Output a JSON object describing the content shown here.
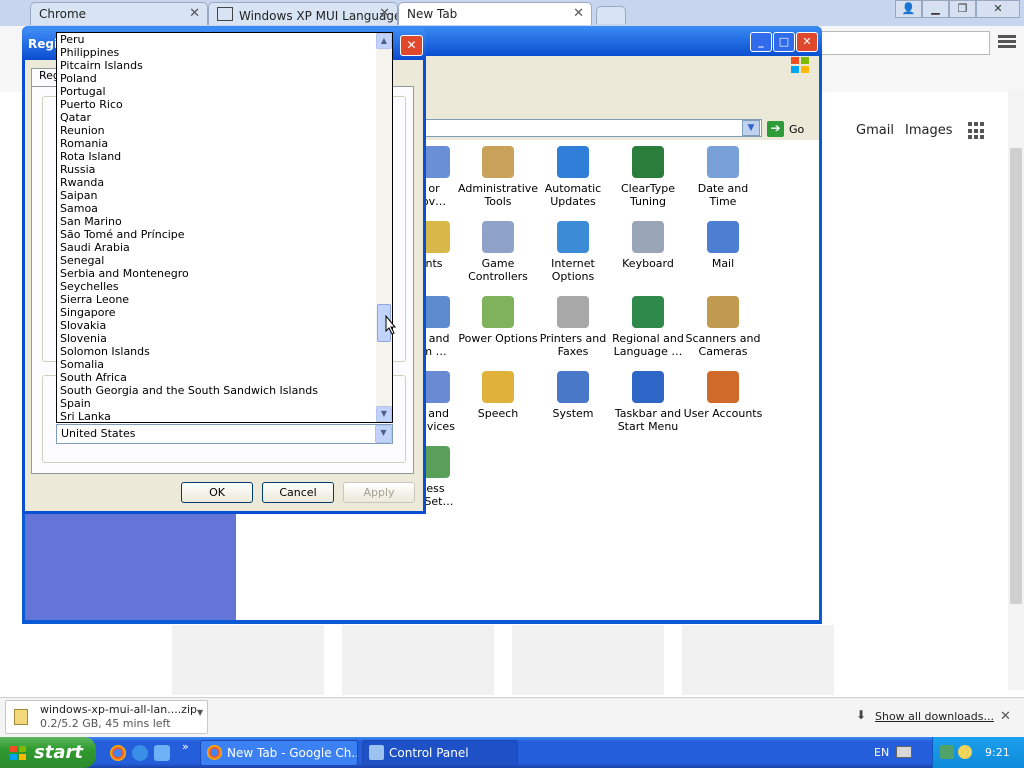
{
  "browser": {
    "tabs": [
      {
        "label": "Chrome",
        "active": false
      },
      {
        "label": "Windows XP MUI Language P",
        "active": false
      },
      {
        "label": "New Tab",
        "active": true
      }
    ],
    "google_links": {
      "gmail": "Gmail",
      "images": "Images"
    }
  },
  "control_panel": {
    "address_go": "Go",
    "items": [
      {
        "label": "or\nov…",
        "icon": "accessibility-icon"
      },
      {
        "label": "Administrative Tools",
        "icon": "administrative-tools-icon"
      },
      {
        "label": "Automatic Updates",
        "icon": "automatic-updates-icon"
      },
      {
        "label": "ClearType Tuning",
        "icon": "cleartype-icon"
      },
      {
        "label": "Date and Time",
        "icon": "date-time-icon"
      },
      {
        "label": "nts",
        "icon": "fonts-icon"
      },
      {
        "label": "Game Controllers",
        "icon": "game-controllers-icon"
      },
      {
        "label": "Internet Options",
        "icon": "internet-options-icon"
      },
      {
        "label": "Keyboard",
        "icon": "keyboard-icon"
      },
      {
        "label": "Mail",
        "icon": "mail-icon"
      },
      {
        "label": "e and\nm …",
        "icon": "phone-modem-icon"
      },
      {
        "label": "Power Options",
        "icon": "power-options-icon"
      },
      {
        "label": "Printers and Faxes",
        "icon": "printers-icon"
      },
      {
        "label": "Regional and Language …",
        "icon": "regional-icon"
      },
      {
        "label": "Scanners and Cameras",
        "icon": "scanners-icon"
      },
      {
        "label": "s and\ndevices",
        "icon": "sounds-icon"
      },
      {
        "label": "Speech",
        "icon": "speech-icon"
      },
      {
        "label": "System",
        "icon": "system-icon"
      },
      {
        "label": "Taskbar and Start Menu",
        "icon": "taskbar-icon"
      },
      {
        "label": "User Accounts",
        "icon": "user-accounts-icon"
      },
      {
        "label": "less\nk Set…",
        "icon": "wireless-icon"
      }
    ]
  },
  "regional_dialog": {
    "title": "Regi",
    "tab_label": "Reg",
    "countries": [
      "Peru",
      "Philippines",
      "Pitcairn Islands",
      "Poland",
      "Portugal",
      "Puerto Rico",
      "Qatar",
      "Reunion",
      "Romania",
      "Rota Island",
      "Russia",
      "Rwanda",
      "Saipan",
      "Samoa",
      "San Marino",
      "São Tomé and Príncipe",
      "Saudi Arabia",
      "Senegal",
      "Serbia and Montenegro",
      "Seychelles",
      "Sierra Leone",
      "Singapore",
      "Slovakia",
      "Slovenia",
      "Solomon Islands",
      "Somalia",
      "South Africa",
      "South Georgia and the South Sandwich Islands",
      "Spain",
      "Sri Lanka"
    ],
    "selected_location": "United States",
    "buttons": {
      "ok": "OK",
      "cancel": "Cancel",
      "apply": "Apply"
    }
  },
  "download": {
    "filename": "windows-xp-mui-all-lan....zip",
    "status": "0.2/5.2 GB, 45 mins left",
    "show_all": "Show all downloads..."
  },
  "taskbar": {
    "start": "start",
    "tasks": [
      {
        "label": "New Tab - Google Ch..."
      },
      {
        "label": "Control Panel"
      }
    ],
    "language": "EN",
    "clock": "9:21"
  }
}
